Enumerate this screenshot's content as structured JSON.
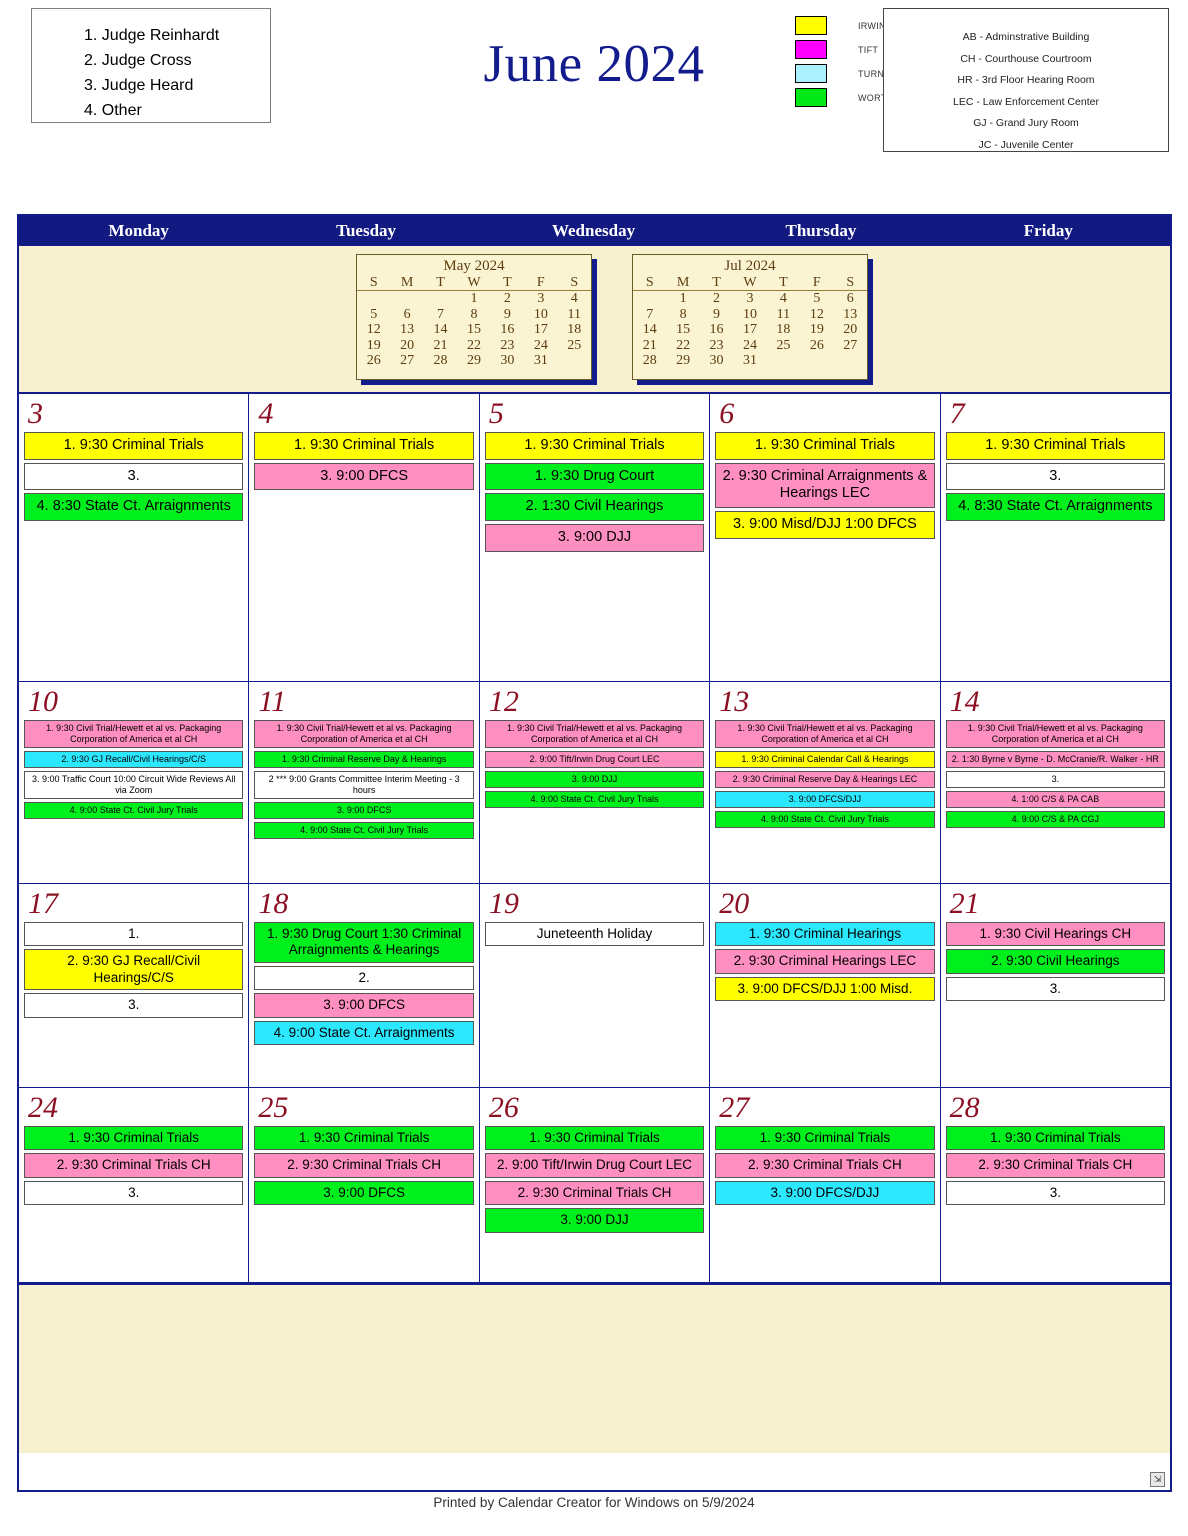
{
  "header": {
    "title": "June 2024",
    "judges": [
      "1. Judge Reinhardt",
      "2. Judge Cross",
      "3. Judge Heard",
      "4. Other"
    ],
    "county_legend": [
      {
        "label": "IRWIN",
        "color": "#ffff00"
      },
      {
        "label": "TIFT",
        "color": "#ff00ff"
      },
      {
        "label": "TURNER",
        "color": "#aaf0ff"
      },
      {
        "label": "WORTH",
        "color": "#00e815"
      }
    ],
    "room_legend": [
      "AB - Adminstrative Building",
      "CH - Courthouse Courtroom",
      "HR - 3rd Floor Hearing Room",
      "LEC - Law Enforcement Center",
      "GJ - Grand Jury Room",
      "JC - Juvenile Center"
    ]
  },
  "day_headers": [
    "Monday",
    "Tuesday",
    "Wednesday",
    "Thursday",
    "Friday"
  ],
  "mini_calendars": [
    {
      "title": "May 2024",
      "dow": [
        "S",
        "M",
        "T",
        "W",
        "T",
        "F",
        "S"
      ],
      "weeks": [
        [
          "",
          "",
          "",
          "1",
          "2",
          "3",
          "4"
        ],
        [
          "5",
          "6",
          "7",
          "8",
          "9",
          "10",
          "11"
        ],
        [
          "12",
          "13",
          "14",
          "15",
          "16",
          "17",
          "18"
        ],
        [
          "19",
          "20",
          "21",
          "22",
          "23",
          "24",
          "25"
        ],
        [
          "26",
          "27",
          "28",
          "29",
          "30",
          "31",
          ""
        ]
      ]
    },
    {
      "title": "Jul 2024",
      "dow": [
        "S",
        "M",
        "T",
        "W",
        "T",
        "F",
        "S"
      ],
      "weeks": [
        [
          "",
          "1",
          "2",
          "3",
          "4",
          "5",
          "6"
        ],
        [
          "7",
          "8",
          "9",
          "10",
          "11",
          "12",
          "13"
        ],
        [
          "14",
          "15",
          "16",
          "17",
          "18",
          "19",
          "20"
        ],
        [
          "21",
          "22",
          "23",
          "24",
          "25",
          "26",
          "27"
        ],
        [
          "28",
          "29",
          "30",
          "31",
          "",
          "",
          ""
        ]
      ]
    }
  ],
  "colors": {
    "irwin_yellow": "#ffff00",
    "tift_pink": "#ff8fc0",
    "turner_cyan": "#2ce8ff",
    "worth_green": "#00f01d",
    "none_white": "#ffffff",
    "frame_blue": "#131c8c",
    "day_number_red": "#8c1023",
    "mini_cal_bg": "#faf4d2"
  },
  "weeks": [
    {
      "size": "s-lg",
      "days": [
        {
          "number": "3",
          "events": [
            {
              "text": "1. 9:30 Criminal Trials",
              "color": "#ffff00"
            },
            {
              "text": "3.",
              "color": "#ffffff"
            },
            {
              "text": "4. 8:30 State Ct. Arraignments",
              "color": "#00f01d"
            }
          ]
        },
        {
          "number": "4",
          "events": [
            {
              "text": "1. 9:30 Criminal Trials",
              "color": "#ffff00"
            },
            {
              "text": "3. 9:00 DFCS",
              "color": "#ff8fc0"
            }
          ]
        },
        {
          "number": "5",
          "events": [
            {
              "text": "1. 9:30 Criminal Trials",
              "color": "#ffff00"
            },
            {
              "text": "1. 9:30 Drug Court",
              "color": "#00f01d"
            },
            {
              "text": "2. 1:30 Civil Hearings",
              "color": "#00f01d"
            },
            {
              "text": "3. 9:00 DJJ",
              "color": "#ff8fc0"
            }
          ]
        },
        {
          "number": "6",
          "events": [
            {
              "text": "1. 9:30 Criminal Trials",
              "color": "#ffff00"
            },
            {
              "text": "2. 9:30 Criminal Arraignments & Hearings LEC",
              "color": "#ff8fc0"
            },
            {
              "text": "3. 9:00 Misd/DJJ 1:00 DFCS",
              "color": "#ffff00"
            }
          ]
        },
        {
          "number": "7",
          "events": [
            {
              "text": "1. 9:30 Criminal Trials",
              "color": "#ffff00"
            },
            {
              "text": "3.",
              "color": "#ffffff"
            },
            {
              "text": "4. 8:30 State Ct. Arraignments",
              "color": "#00f01d"
            }
          ]
        }
      ]
    },
    {
      "size": "s-xs",
      "days": [
        {
          "number": "10",
          "events": [
            {
              "text": "1. 9:30 Civil Trial/Hewett et al vs. Packaging Corporation of America et al CH",
              "color": "#ff8fc0"
            },
            {
              "text": "2. 9:30 GJ Recall/Civil Hearings/C/S",
              "color": "#2ce8ff"
            },
            {
              "text": "3. 9:00 Traffic Court 10:00 Circuit Wide Reviews All via Zoom",
              "color": "#ffffff"
            },
            {
              "text": "4. 9:00 State Ct. Civil Jury Trials",
              "color": "#00f01d"
            }
          ]
        },
        {
          "number": "11",
          "events": [
            {
              "text": "1. 9:30 Civil Trial/Hewett et al vs. Packaging Corporation of America et al CH",
              "color": "#ff8fc0"
            },
            {
              "text": "1. 9:30 Criminal Reserve Day & Hearings",
              "color": "#00f01d"
            },
            {
              "text": "2 *** 9:00  Grants Committee Interim Meeting  - 3 hours",
              "color": "#ffffff"
            },
            {
              "text": "3. 9:00 DFCS",
              "color": "#00f01d"
            },
            {
              "text": "4. 9:00 State Ct. Civil Jury Trials",
              "color": "#00f01d"
            }
          ]
        },
        {
          "number": "12",
          "events": [
            {
              "text": "1. 9:30 Civil Trial/Hewett et al vs. Packaging Corporation of America et al CH",
              "color": "#ff8fc0"
            },
            {
              "text": "2. 9:00 Tift/Irwin Drug Court LEC",
              "color": "#ff8fc0"
            },
            {
              "text": "3. 9:00 DJJ",
              "color": "#00f01d"
            },
            {
              "text": "4. 9:00 State Ct. Civil Jury Trials",
              "color": "#00f01d"
            }
          ]
        },
        {
          "number": "13",
          "events": [
            {
              "text": "1.  9:30 Civil Trial/Hewett et al vs. Packaging Corporation of America et al CH",
              "color": "#ff8fc0"
            },
            {
              "text": "1. 9:30 Criminal Calendar Call & Hearings",
              "color": "#ffff00"
            },
            {
              "text": "2. 9:30 Criminal Reserve Day & Hearings LEC",
              "color": "#ff8fc0"
            },
            {
              "text": "3.  9:00  DFCS/DJJ",
              "color": "#2ce8ff"
            },
            {
              "text": "4. 9:00  State Ct. Civil Jury Trials",
              "color": "#00f01d"
            }
          ]
        },
        {
          "number": "14",
          "events": [
            {
              "text": "1. 9:30 Civil Trial/Hewett et al vs. Packaging Corporation of America et al CH",
              "color": "#ff8fc0"
            },
            {
              "text": "2. 1:30 Byrne v Byrne - D. McCranie/R. Walker - HR",
              "color": "#ff8fc0"
            },
            {
              "text": "3.",
              "color": "#ffffff"
            },
            {
              "text": "4. 1:00 C/S & PA CAB",
              "color": "#ff8fc0"
            },
            {
              "text": "4. 9:00 C/S & PA CGJ",
              "color": "#00f01d"
            }
          ]
        }
      ]
    },
    {
      "size": "s-md",
      "days": [
        {
          "number": "17",
          "events": [
            {
              "text": "1.",
              "color": "#ffffff"
            },
            {
              "text": "2. 9:30 GJ Recall/Civil Hearings/C/S",
              "color": "#ffff00"
            },
            {
              "text": "3.",
              "color": "#ffffff"
            }
          ]
        },
        {
          "number": "18",
          "events": [
            {
              "text": "1. 9:30 Drug Court 1:30 Criminal Arraignments & Hearings",
              "color": "#00f01d"
            },
            {
              "text": "2.",
              "color": "#ffffff"
            },
            {
              "text": "3. 9:00 DFCS",
              "color": "#ff8fc0"
            },
            {
              "text": "4. 9:00 State Ct. Arraignments",
              "color": "#2ce8ff"
            }
          ]
        },
        {
          "number": "19",
          "events": [
            {
              "text": "Juneteenth Holiday",
              "color": "#ffffff"
            }
          ]
        },
        {
          "number": "20",
          "events": [
            {
              "text": "1. 9:30 Criminal Hearings",
              "color": "#2ce8ff"
            },
            {
              "text": "2. 9:30 Criminal Hearings LEC",
              "color": "#ff8fc0"
            },
            {
              "text": "3. 9:00 DFCS/DJJ 1:00 Misd.",
              "color": "#ffff00"
            }
          ]
        },
        {
          "number": "21",
          "events": [
            {
              "text": "1. 9:30 Civil Hearings CH",
              "color": "#ff8fc0"
            },
            {
              "text": "2. 9:30 Civil Hearings",
              "color": "#00f01d"
            },
            {
              "text": "3.",
              "color": "#ffffff"
            }
          ]
        }
      ]
    },
    {
      "size": "s-md",
      "days": [
        {
          "number": "24",
          "events": [
            {
              "text": "1. 9:30 Criminal Trials",
              "color": "#00f01d"
            },
            {
              "text": "2. 9:30 Criminal Trials CH",
              "color": "#ff8fc0"
            },
            {
              "text": "3.",
              "color": "#ffffff"
            }
          ]
        },
        {
          "number": "25",
          "events": [
            {
              "text": "1. 9:30 Criminal Trials",
              "color": "#00f01d"
            },
            {
              "text": "2. 9:30 Criminal Trials CH",
              "color": "#ff8fc0"
            },
            {
              "text": "3. 9:00 DFCS",
              "color": "#00f01d"
            }
          ]
        },
        {
          "number": "26",
          "events": [
            {
              "text": "1. 9:30 Criminal Trials",
              "color": "#00f01d"
            },
            {
              "text": "2. 9:00 Tift/Irwin Drug Court LEC",
              "color": "#ff8fc0"
            },
            {
              "text": "2. 9:30 Criminal Trials CH",
              "color": "#ff8fc0"
            },
            {
              "text": "3. 9:00 DJJ",
              "color": "#00f01d"
            }
          ]
        },
        {
          "number": "27",
          "events": [
            {
              "text": "1. 9:30 Criminal Trials",
              "color": "#00f01d"
            },
            {
              "text": "2. 9:30 Criminal Trials CH",
              "color": "#ff8fc0"
            },
            {
              "text": "3. 9:00 DFCS/DJJ",
              "color": "#2ce8ff"
            }
          ]
        },
        {
          "number": "28",
          "events": [
            {
              "text": "1. 9:30 Criminal Trials",
              "color": "#00f01d"
            },
            {
              "text": "2. 9:30 Criminal Trials CH",
              "color": "#ff8fc0"
            },
            {
              "text": "3.",
              "color": "#ffffff"
            }
          ]
        }
      ]
    }
  ],
  "footer": {
    "text": "Printed by Calendar Creator for Windows on 5/9/2024"
  },
  "resize_handle": {
    "glyph": "⇲"
  }
}
